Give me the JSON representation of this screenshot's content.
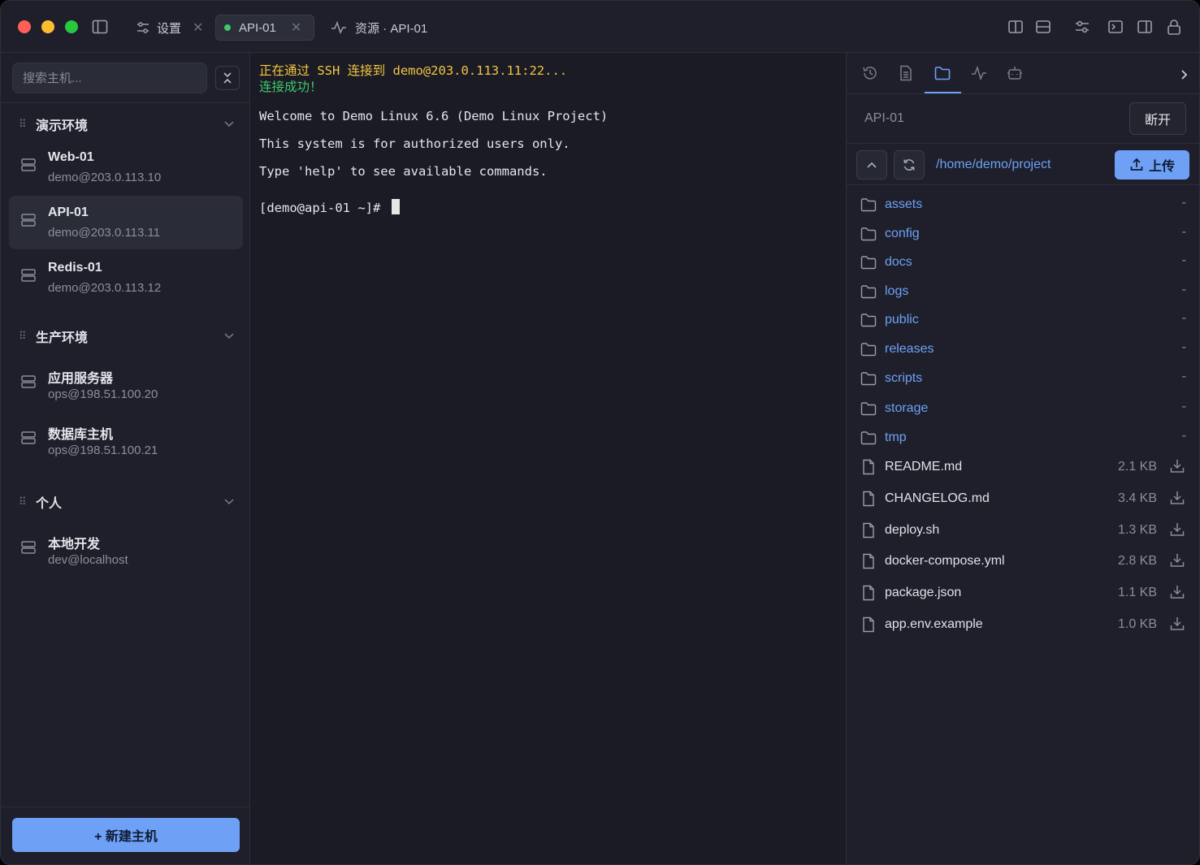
{
  "window": {
    "traffic_lights": {
      "close": "#ff5f57",
      "minimize": "#febc2e",
      "zoom": "#28c840"
    }
  },
  "tabs": [
    {
      "label": "设置",
      "icon": "sliders-icon",
      "closable": true
    },
    {
      "label": "API-01",
      "status_color": "#3fc76a",
      "active": true,
      "closable": true
    },
    {
      "label": "资源 · API-01",
      "icon": "activity-icon"
    }
  ],
  "toolbar_icons": [
    "split-vertical-icon",
    "split-horizontal-icon",
    "sliders-icon",
    "terminal-icon",
    "sidebar-right-icon",
    "lock-icon"
  ],
  "sidebar": {
    "search_placeholder": "搜索主机...",
    "groups": [
      {
        "name": "演示环境",
        "hosts": [
          {
            "name": "Web-01",
            "address": "demo@203.0.113.10"
          },
          {
            "name": "API-01",
            "address": "demo@203.0.113.11",
            "active": true
          },
          {
            "name": "Redis-01",
            "address": "demo@203.0.113.12"
          }
        ]
      },
      {
        "name": "生产环境",
        "hosts": [
          {
            "name": "应用服务器",
            "address": "ops@198.51.100.20"
          },
          {
            "name": "数据库主机",
            "address": "ops@198.51.100.21"
          }
        ]
      },
      {
        "name": "个人",
        "hosts": [
          {
            "name": "本地开发",
            "address": "dev@localhost"
          }
        ]
      }
    ],
    "new_host_label": "+ 新建主机"
  },
  "terminal": {
    "connecting": "正在通过 SSH 连接到 demo@203.0.113.11:22...",
    "connected": "连接成功！",
    "lines": [
      "Welcome to Demo Linux 6.6 (Demo Linux Project)",
      "This system is for authorized users only.",
      "Type 'help' to see available commands."
    ],
    "prompt": "[demo@api-01 ~]# ",
    "colors": {
      "connecting": "#f5c542",
      "connected": "#3fc76a",
      "text": "#e4e6ec"
    }
  },
  "right_panel": {
    "tabs": [
      "history-icon",
      "document-icon",
      "folder-icon",
      "activity-icon",
      "robot-icon"
    ],
    "active_tab": "folder-icon",
    "connection_name": "API-01",
    "disconnect_label": "断开",
    "path": "/home/demo/project",
    "upload_label": "上传",
    "directories": [
      "assets",
      "config",
      "docs",
      "logs",
      "public",
      "releases",
      "scripts",
      "storage",
      "tmp"
    ],
    "directory_size": "-",
    "files": [
      {
        "name": "README.md",
        "size": "2.1 KB"
      },
      {
        "name": "CHANGELOG.md",
        "size": "3.4 KB"
      },
      {
        "name": "deploy.sh",
        "size": "1.3 KB"
      },
      {
        "name": "docker-compose.yml",
        "size": "2.8 KB"
      },
      {
        "name": "package.json",
        "size": "1.1 KB"
      },
      {
        "name": "app.env.example",
        "size": "1.0 KB"
      }
    ]
  },
  "colors": {
    "accent": "#6ea1f5",
    "background": "#1a1b25",
    "panel": "#1e1f2a"
  }
}
